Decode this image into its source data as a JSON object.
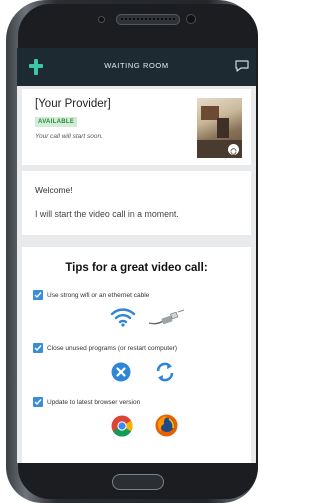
{
  "header": {
    "title": "WAITING ROOM",
    "logo_icon": "medical-plus-logo-icon",
    "chat_icon": "chat-bubble-icon"
  },
  "provider_card": {
    "name": "[Your Provider]",
    "status": "AVAILABLE",
    "status_color": "#2a8a3c",
    "subtitle": "Your call will start soon."
  },
  "welcome_card": {
    "heading": "Welcome!",
    "message": "I will start the video call in a moment."
  },
  "tips_card": {
    "title": "Tips for a great video call:",
    "tips": [
      {
        "text": "Use strong wifi or an ethernet cable",
        "icons": [
          "wifi-icon",
          "ethernet-cable-icon"
        ]
      },
      {
        "text": "Close unused programs (or restart computer)",
        "icons": [
          "close-circle-icon",
          "refresh-icon"
        ]
      },
      {
        "text": "Update to latest browser version",
        "icons": [
          "chrome-icon",
          "firefox-icon"
        ]
      }
    ]
  },
  "colors": {
    "accent": "#3a8ed8",
    "header_bg": "#1e2a31",
    "logo": "#3cc6a8"
  }
}
